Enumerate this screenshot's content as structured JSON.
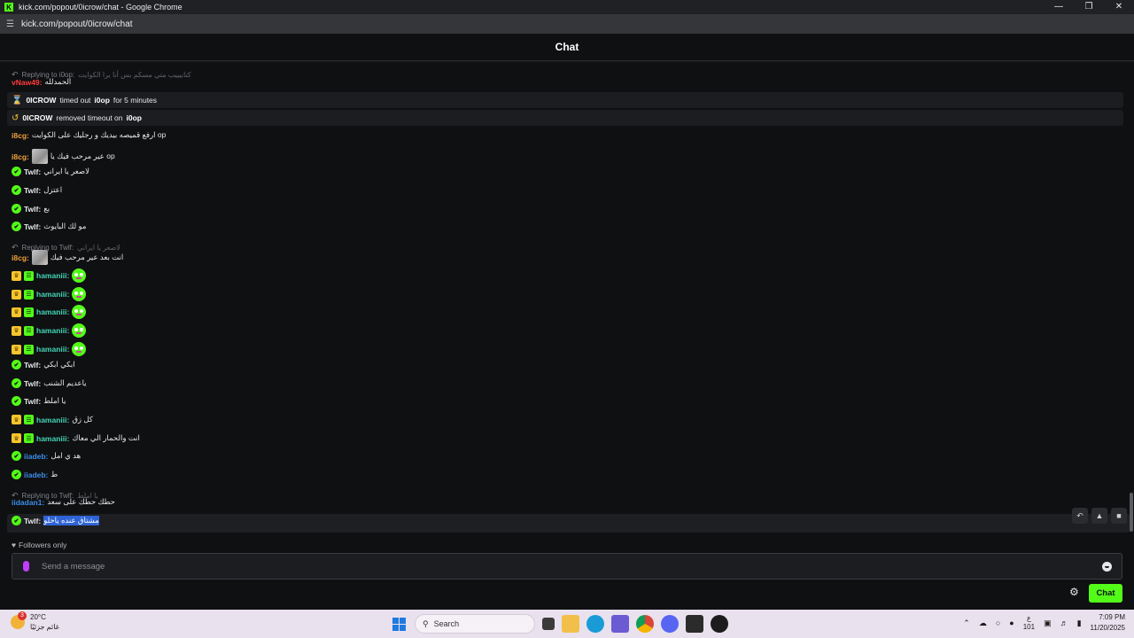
{
  "window": {
    "title": "kick.com/popout/0icrow/chat - Google Chrome",
    "url": "kick.com/popout/0icrow/chat"
  },
  "chat": {
    "header": "Chat",
    "messages": [
      {
        "type": "reply",
        "to": "Replying to i0op:",
        "text": "كتابيييب متي مسكم بس أنا يرا الكوايت"
      },
      {
        "type": "msg",
        "user": "vNaw49",
        "color": "red",
        "text": "الحمدلله"
      },
      {
        "type": "sys",
        "icon": "hourglass",
        "actor": "0ICROW",
        "action": "timed out",
        "target": "i0op",
        "suffix": "for 5 minutes"
      },
      {
        "type": "sys",
        "icon": "undo",
        "actor": "0ICROW",
        "action": "removed timeout on",
        "target": "i0op",
        "suffix": ""
      },
      {
        "type": "msg",
        "user": "i8cg",
        "color": "orange",
        "text": "ارفع قميصه بيديك و رجليك على الكوايت op"
      },
      {
        "type": "msg",
        "user": "i8cg",
        "color": "orange",
        "text": "عير مرحب فيك يا op",
        "emote": true
      },
      {
        "type": "msg",
        "user": "Twlf",
        "color": "white",
        "badges": [
          "verified"
        ],
        "text": "لاصعر يا ايراني"
      },
      {
        "type": "msg",
        "user": "Twlf",
        "color": "white",
        "badges": [
          "verified"
        ],
        "text": "اعتزل"
      },
      {
        "type": "msg",
        "user": "Twlf",
        "color": "white",
        "badges": [
          "verified"
        ],
        "text": "بع"
      },
      {
        "type": "msg",
        "user": "Twlf",
        "color": "white",
        "badges": [
          "verified"
        ],
        "text": "مو لك البايوث"
      },
      {
        "type": "reply",
        "to": "Replying to Twlf:",
        "text": "لاصعر يا ايراني"
      },
      {
        "type": "msg",
        "user": "i8cg",
        "color": "orange",
        "text": "انت بعد عير مرحب فيك",
        "emote": true
      },
      {
        "type": "msg",
        "user": "hamaniii",
        "color": "green",
        "badges": [
          "crown",
          "gift"
        ],
        "text": "",
        "face": true
      },
      {
        "type": "msg",
        "user": "hamaniii",
        "color": "green",
        "badges": [
          "crown",
          "gift"
        ],
        "text": "",
        "face": true
      },
      {
        "type": "msg",
        "user": "hamaniii",
        "color": "green",
        "badges": [
          "crown",
          "gift"
        ],
        "text": "",
        "face": true
      },
      {
        "type": "msg",
        "user": "hamaniii",
        "color": "green",
        "badges": [
          "crown",
          "gift"
        ],
        "text": "",
        "face": true
      },
      {
        "type": "msg",
        "user": "hamaniii",
        "color": "green",
        "badges": [
          "crown",
          "gift"
        ],
        "text": "",
        "face": true
      },
      {
        "type": "msg",
        "user": "Twlf",
        "color": "white",
        "badges": [
          "verified"
        ],
        "text": "ابكي ابكي"
      },
      {
        "type": "msg",
        "user": "Twlf",
        "color": "white",
        "badges": [
          "verified"
        ],
        "text": "ياعديم الشنب"
      },
      {
        "type": "msg",
        "user": "Twlf",
        "color": "white",
        "badges": [
          "verified"
        ],
        "text": "يا املط"
      },
      {
        "type": "msg",
        "user": "hamaniii",
        "color": "green",
        "badges": [
          "crown",
          "gift"
        ],
        "text": "كل زق"
      },
      {
        "type": "msg",
        "user": "hamaniii",
        "color": "green",
        "badges": [
          "crown",
          "gift"
        ],
        "text": "انت والحمار الي معاك"
      },
      {
        "type": "msg",
        "user": "iiadeb",
        "color": "blue",
        "badges": [
          "verified"
        ],
        "text": "هد ي امل"
      },
      {
        "type": "msg",
        "user": "iiadeb",
        "color": "blue",
        "badges": [
          "verified"
        ],
        "text": "ط"
      },
      {
        "type": "reply",
        "to": "Replying to Twlf:",
        "text": "يا املط"
      },
      {
        "type": "msg",
        "user": "iidadan1",
        "color": "blue",
        "text": "حطك حطك على سعد"
      },
      {
        "type": "msg",
        "user": "Twlf",
        "color": "white",
        "badges": [
          "verified"
        ],
        "text": "مشتاق عنده ياحلو",
        "selected": true
      }
    ],
    "followers_only": "Followers only",
    "input_placeholder": "Send a message",
    "send_label": "Chat"
  },
  "taskbar": {
    "weather_temp": "20°C",
    "weather_desc": "غائم جزئيًا",
    "weather_badge": "3",
    "search_label": "Search",
    "lang_top": "ع",
    "lang_bottom": "101",
    "time": "7:09 PM",
    "date": "11/20/2025"
  },
  "colors": {
    "accent": "#53fc18",
    "background": "#0f1012"
  }
}
